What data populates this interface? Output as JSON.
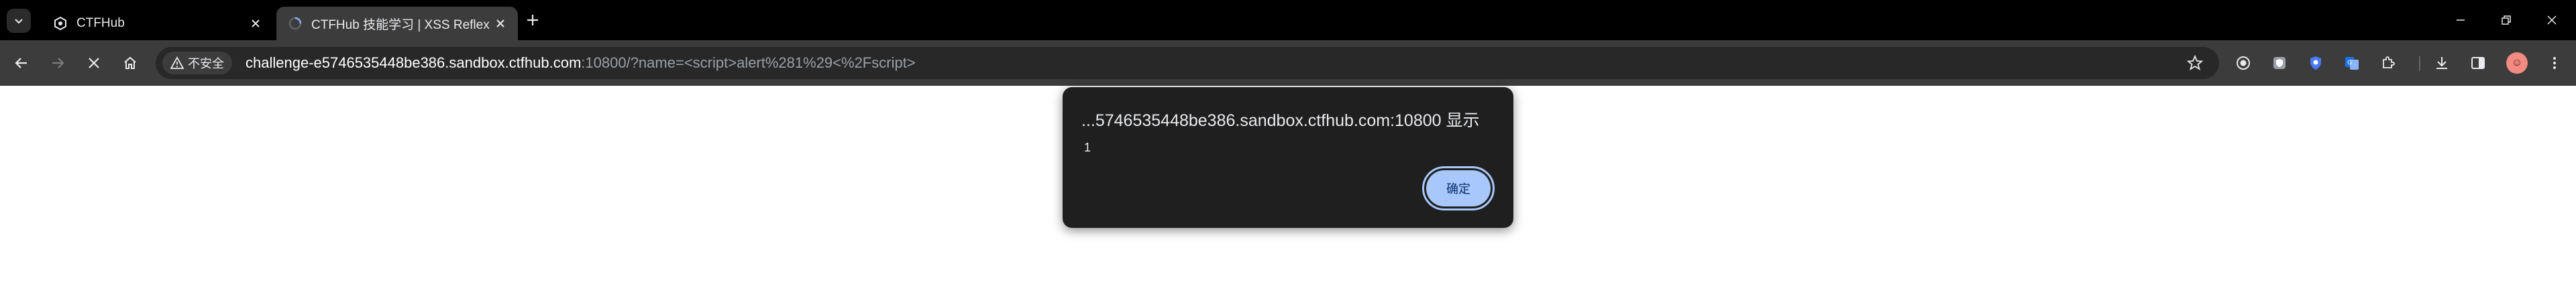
{
  "tabs": [
    {
      "title": "CTFHub",
      "favicon": "ctfhub-favicon-icon"
    },
    {
      "title": "CTFHub 技能学习 | XSS Reflex",
      "favicon": "loading-favicon-icon"
    }
  ],
  "omnibox": {
    "security_label": "不安全",
    "url_host": "challenge-e5746535448be386.sandbox.ctfhub.com",
    "url_rest": ":10800/?name=<script>alert%281%29<%2Fscript>"
  },
  "dialog": {
    "title": "...5746535448be386.sandbox.ctfhub.com:10800 显示",
    "message": "1",
    "ok_label": "确定"
  },
  "colors": {
    "tab_strip": "#000000",
    "toolbar": "#3c3c3c",
    "omnibox": "#282828",
    "dialog_bg": "#1f1f1f",
    "accent": "#a8c7fa"
  }
}
